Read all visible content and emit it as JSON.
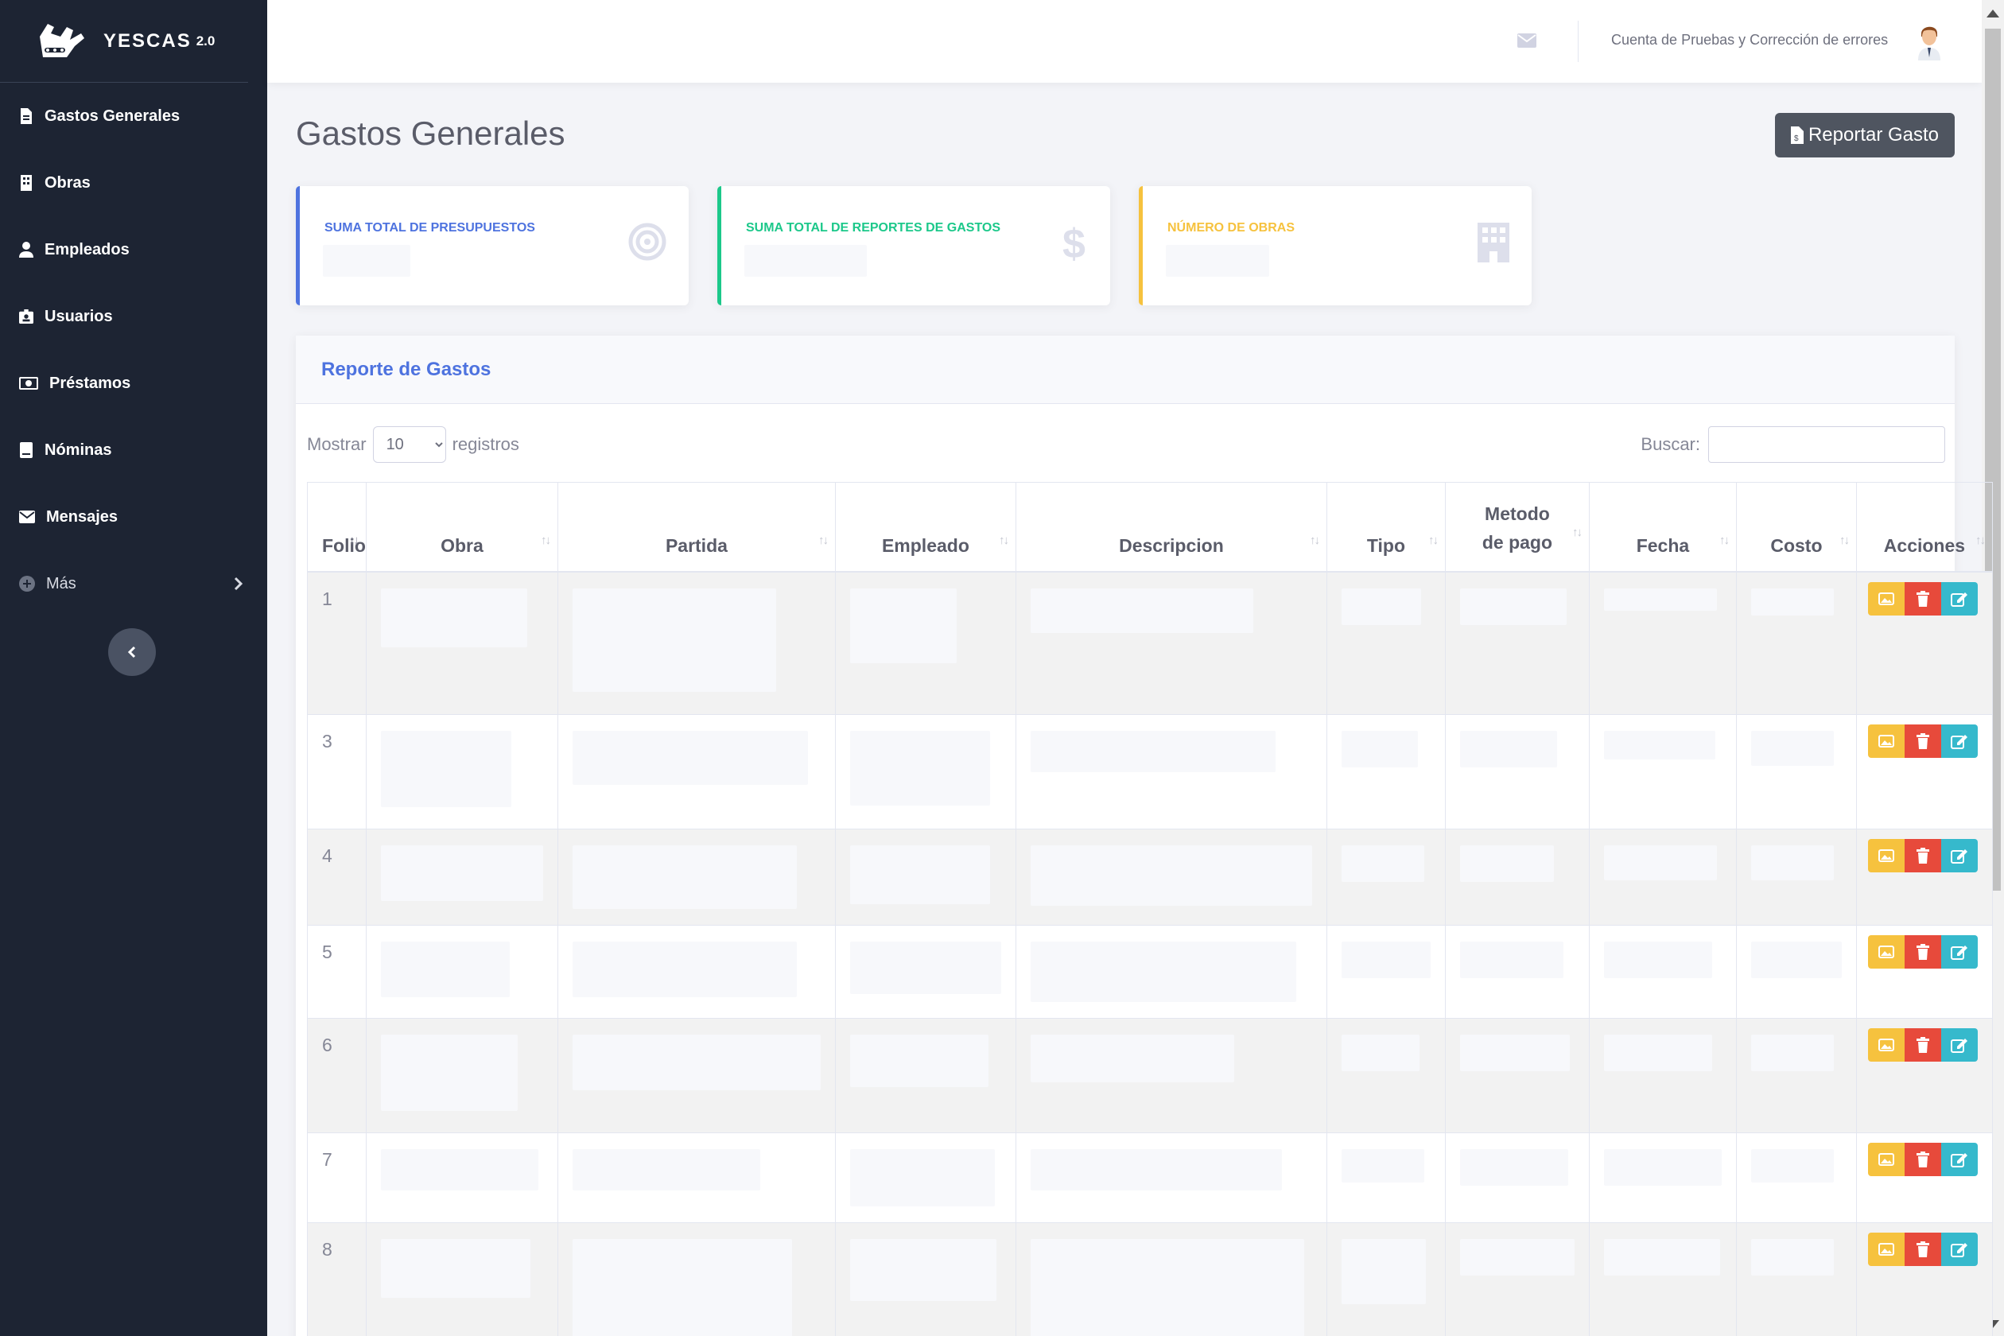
{
  "brand": {
    "name": "YESCAS",
    "version": "2.0"
  },
  "sidebar": {
    "items": [
      {
        "label": "Gastos Generales"
      },
      {
        "label": "Obras"
      },
      {
        "label": "Empleados"
      },
      {
        "label": "Usuarios"
      },
      {
        "label": "Préstamos"
      },
      {
        "label": "Nóminas"
      },
      {
        "label": "Mensajes"
      },
      {
        "label": "Más"
      }
    ]
  },
  "topbar": {
    "user_name": "Cuenta de Pruebas y Corrección de errores"
  },
  "page": {
    "title": "Gastos Generales",
    "report_button": "Reportar Gasto"
  },
  "cards": [
    {
      "label": "SUMA TOTAL DE PRESUPUESTOS",
      "color": "#4e73df",
      "icon": "target-icon"
    },
    {
      "label": "SUMA TOTAL DE REPORTES DE GASTOS",
      "color": "#1cc88a",
      "icon": "dollar-icon"
    },
    {
      "label": "NÚMERO DE OBRAS",
      "color": "#f6c23e",
      "icon": "building-icon"
    }
  ],
  "panel": {
    "title": "Reporte de Gastos",
    "show_prefix": "Mostrar",
    "show_value": "10",
    "show_suffix": "registros",
    "search_label": "Buscar:",
    "columns": [
      "Folio",
      "Obra",
      "Partida",
      "Empleado",
      "Descripcion",
      "Tipo",
      "Metodo de pago",
      "Fecha",
      "Costo",
      "Acciones"
    ],
    "rows": [
      {
        "folio": "1"
      },
      {
        "folio": "3"
      },
      {
        "folio": "4"
      },
      {
        "folio": "5"
      },
      {
        "folio": "6"
      },
      {
        "folio": "7"
      },
      {
        "folio": "8"
      }
    ]
  }
}
